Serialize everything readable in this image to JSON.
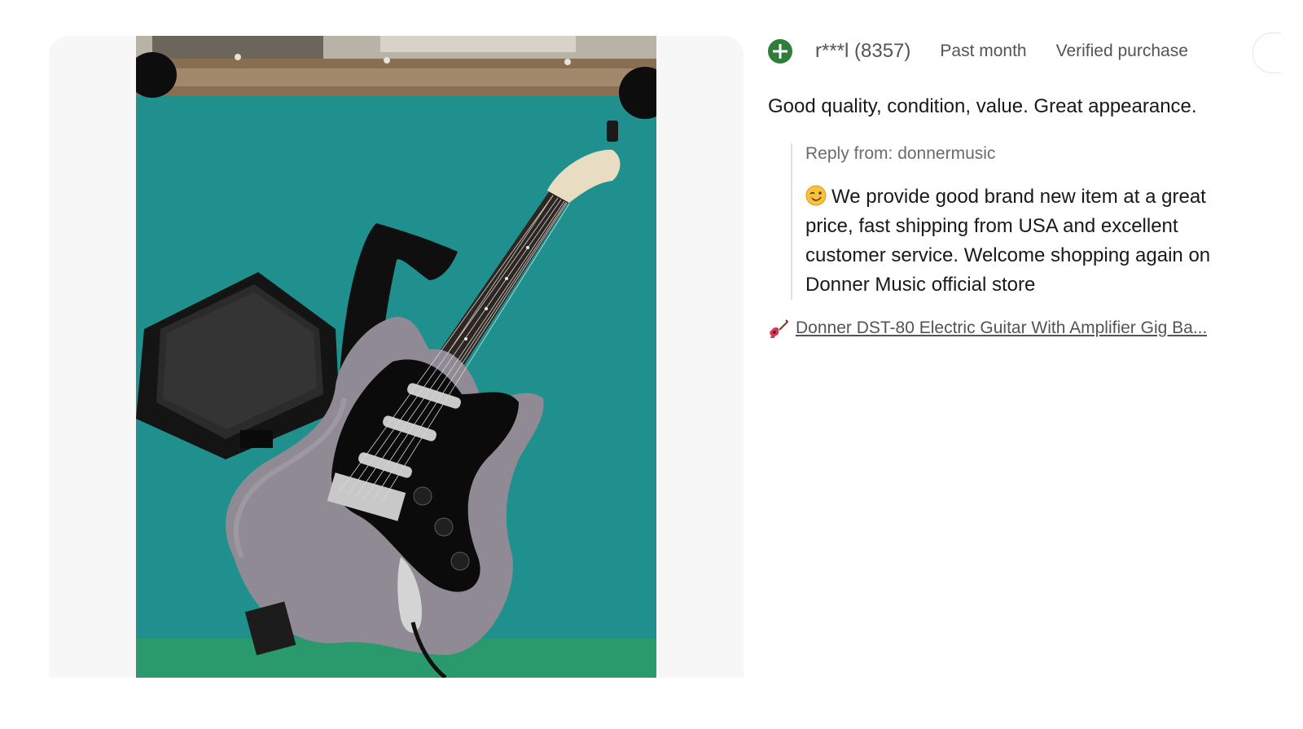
{
  "review": {
    "reviewer": "r***l (8357)",
    "date": "Past month",
    "verified": "Verified purchase",
    "text": "Good quality, condition, value. Great appearance.",
    "reply": {
      "from": "Reply from: donnermusic",
      "text": "We provide good brand new item at a great price, fast shipping from USA and excellent customer service. Welcome shopping again on Donner Music official store"
    },
    "item": {
      "title": "Donner DST-80 Electric Guitar With Amplifier Gig Ba..."
    }
  },
  "icons": {
    "user": "plus-circle-icon",
    "reply_emoji": "wink-emoji-icon",
    "item": "guitar-icon"
  },
  "colors": {
    "user_icon": "#2f7d38",
    "text": "#191919",
    "muted": "#545454"
  }
}
